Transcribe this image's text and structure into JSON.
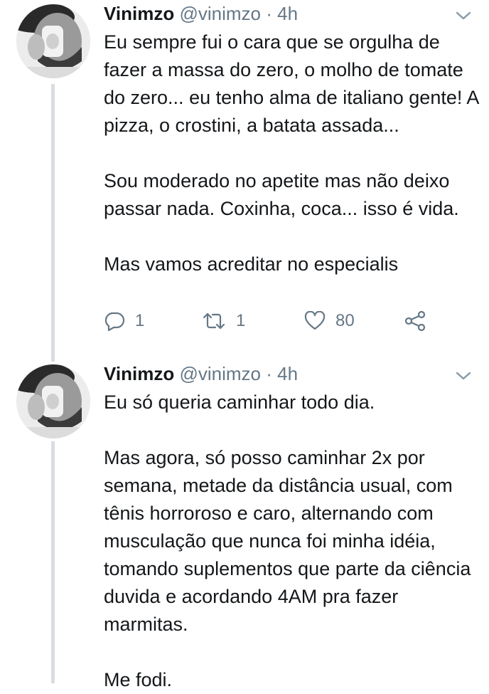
{
  "tweets": [
    {
      "author_name": "Vinimzo",
      "handle": "@vinimzo",
      "separator": "·",
      "time": "4h",
      "paragraphs": [
        "Eu sempre fui o cara que se orgulha de fazer a massa do zero, o molho de tomate do zero... eu tenho alma de italiano gente! A pizza, o crostini, a batata assada...",
        "Sou moderado no apetite mas não deixo passar nada. Coxinha, coca... isso é vida.",
        "Mas vamos acreditar no especialis"
      ],
      "actions": {
        "reply_count": "1",
        "retweet_count": "1",
        "like_count": "80"
      }
    },
    {
      "author_name": "Vinimzo",
      "handle": "@vinimzo",
      "separator": "·",
      "time": "4h",
      "paragraphs": [
        "Eu só queria caminhar todo dia.",
        "Mas agora, só posso caminhar 2x por semana, metade da distância usual, com tênis horroroso e caro, alternando com musculação que nunca foi minha idéia, tomando suplementos que parte da ciência duvida e acordando 4AM pra fazer marmitas.",
        "Me fodi."
      ]
    }
  ],
  "icons": {
    "reply": "reply-icon",
    "retweet": "retweet-icon",
    "like": "heart-icon",
    "share": "share-icon",
    "more": "chevron-down-icon"
  },
  "colors": {
    "text": "#14171a",
    "secondary": "#657786",
    "thread_line": "#d8dde2"
  }
}
